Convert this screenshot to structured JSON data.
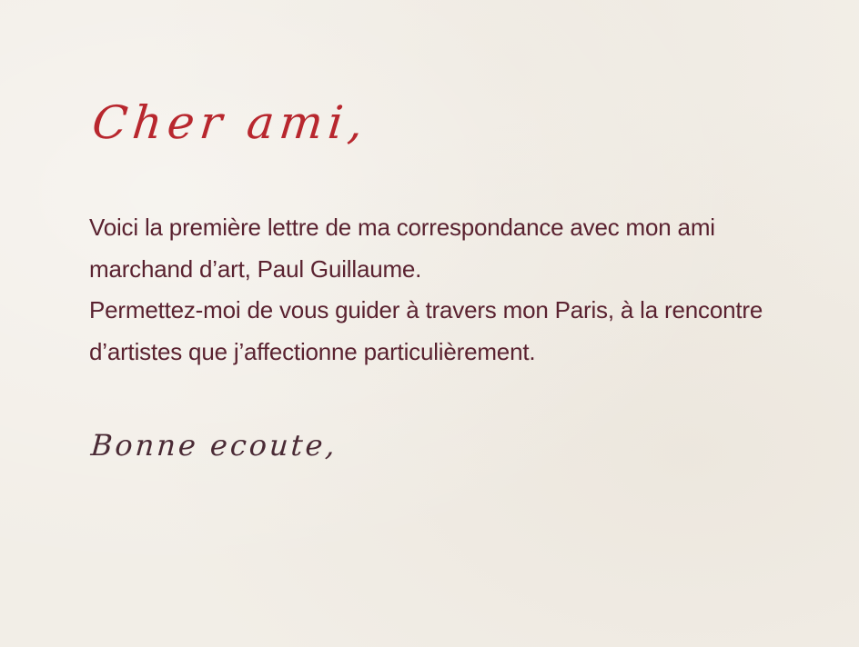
{
  "letter": {
    "greeting": "Cher ami,",
    "paragraph_1": "Voici la première lettre de ma correspondance avec mon ami marchand d’art, Paul Guillaume.",
    "paragraph_2": "Permettez-moi de vous guider à travers mon Paris, à la rencontre d’artistes que j’affectionne particulièrement.",
    "signoff": "Bonne ecoute,"
  },
  "colors": {
    "background": "#f2eee7",
    "greeting": "#b8272e",
    "body_text": "#5a2230",
    "signoff": "#4a2a35"
  }
}
